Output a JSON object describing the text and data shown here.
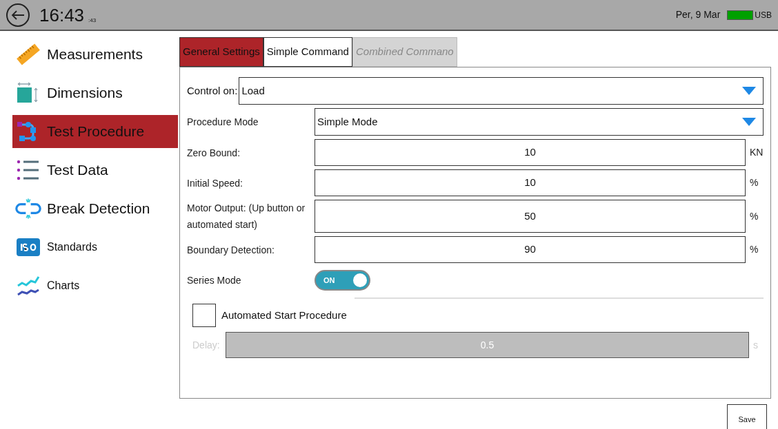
{
  "header": {
    "time": "16:43",
    "seconds": ":43",
    "date": "Per, 9 Mar",
    "usb": "USB"
  },
  "sidebar": {
    "items": [
      {
        "label": "Measurements",
        "selected": false,
        "kind": "large"
      },
      {
        "label": "Dimensions",
        "selected": false,
        "kind": "large"
      },
      {
        "label": "Test Procedure",
        "selected": true,
        "kind": "large"
      },
      {
        "label": "Test Data",
        "selected": false,
        "kind": "large"
      },
      {
        "label": "Break Detection",
        "selected": false,
        "kind": "large"
      },
      {
        "label": "Standards",
        "selected": false,
        "kind": "small"
      },
      {
        "label": "Charts",
        "selected": false,
        "kind": "small"
      }
    ]
  },
  "tabs": [
    {
      "label": "General  Settings",
      "selected": true,
      "disabled": false
    },
    {
      "label": "Simple Command",
      "selected": false,
      "disabled": false
    },
    {
      "label": "Combined Commano",
      "selected": false,
      "disabled": true
    }
  ],
  "control_on": {
    "label": "Control on:",
    "value": "Load"
  },
  "rows": [
    {
      "kind": "dropdown",
      "label": "Procedure Mode",
      "value": "Simple Mode"
    },
    {
      "kind": "number",
      "label": "Zero Bound:",
      "value": "10",
      "unit": "KN"
    },
    {
      "kind": "number",
      "label": "Initial Speed:",
      "value": "10",
      "unit": "%"
    },
    {
      "kind": "number",
      "label": " Motor Output: (Up button or automated start)",
      "value": "50",
      "unit": "%"
    },
    {
      "kind": "number",
      "label": "Boundary Detection:",
      "value": "90",
      "unit": "%"
    },
    {
      "kind": "toggle",
      "label": "Series Mode",
      "on": true,
      "on_label": "ON"
    }
  ],
  "automated_start": {
    "label": "Automated Start Procedure",
    "checked": false
  },
  "delay": {
    "label": "Delay:",
    "value": "0.5",
    "unit": "s",
    "disabled": true
  },
  "save": "Save"
}
